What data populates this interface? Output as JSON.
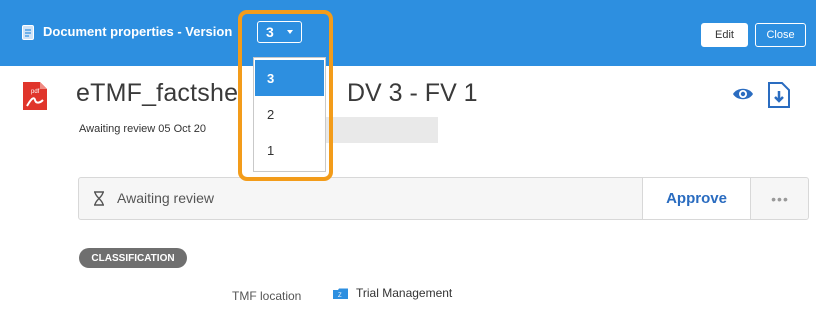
{
  "header": {
    "title": "Document properties  - Version",
    "version_selected": "3",
    "edit_label": "Edit",
    "close_label": "Close",
    "background_color": "#2d8fe0"
  },
  "version_dropdown": {
    "options": [
      "3",
      "2",
      "1"
    ],
    "selected_index": 0
  },
  "document": {
    "icon": "pdf-icon",
    "title_left": "eTMF_factshe",
    "title_right": "DV 3 - FV 1",
    "subtitle": "Awaiting review 05 Oct 20",
    "actions": [
      "eye-icon",
      "download-icon"
    ]
  },
  "review": {
    "status_icon": "hourglass-icon",
    "status_text": "Awaiting review",
    "approve_label": "Approve",
    "more_label": "•••",
    "accent_color": "#2a6cc0"
  },
  "classification": {
    "section_label": "CLASSIFICATION",
    "fields": [
      {
        "label": "TMF location",
        "icon": "folder-icon",
        "value": "Trial Management"
      }
    ]
  },
  "highlight_color": "#f39c1a"
}
